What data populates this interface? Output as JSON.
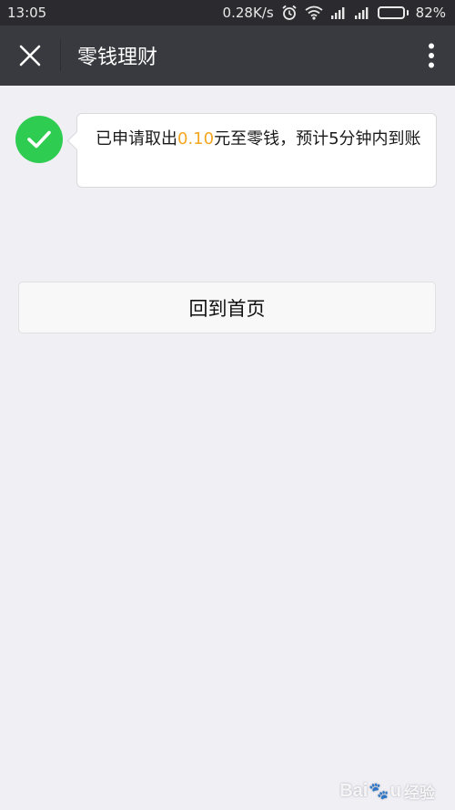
{
  "status_bar": {
    "time": "13:05",
    "network_speed": "0.28K/s",
    "battery_percent": "82%",
    "battery_level": 0.82,
    "icons": [
      "alarm-icon",
      "wifi-icon",
      "signal-icon",
      "signal-icon",
      "battery-icon"
    ]
  },
  "title_bar": {
    "title": "零钱理财",
    "close_icon": "close-icon",
    "more_icon": "more-vertical-icon",
    "background": "#393a3f"
  },
  "notice": {
    "icon": "check-icon",
    "icon_color": "#2ecc50",
    "text_before": "已申请取出",
    "amount": "0.10",
    "amount_color": "#f5a623",
    "text_after": "元至零钱，预计5分钟内到账"
  },
  "actions": {
    "home_label": "回到首页"
  },
  "watermark": {
    "brand_left": "Bai",
    "brand_right": "u",
    "suffix": "经验"
  }
}
